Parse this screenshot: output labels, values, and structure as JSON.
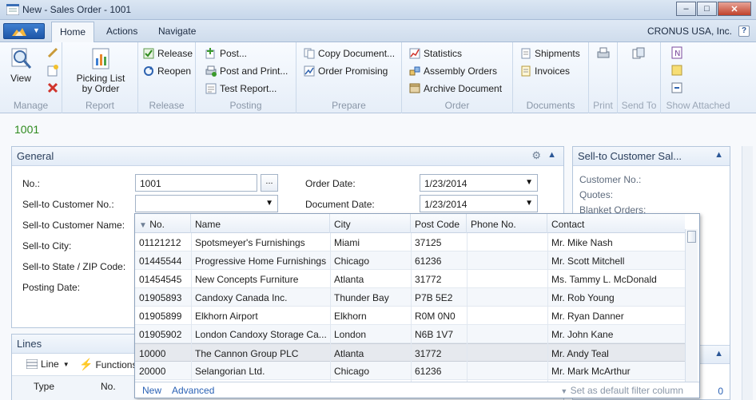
{
  "window": {
    "title": "New - Sales Order - 1001"
  },
  "tabs": [
    {
      "label": "Home",
      "active": true
    },
    {
      "label": "Actions",
      "active": false
    },
    {
      "label": "Navigate",
      "active": false
    }
  ],
  "company": "CRONUS USA, Inc.",
  "ribbon": {
    "manage": {
      "caption": "Manage",
      "view": "View"
    },
    "report": {
      "caption": "Report",
      "picking_line1": "Picking List",
      "picking_line2": "by Order"
    },
    "release": {
      "caption": "Release",
      "release": "Release",
      "reopen": "Reopen"
    },
    "posting": {
      "caption": "Posting",
      "post": "Post...",
      "post_print": "Post and Print...",
      "test_report": "Test Report..."
    },
    "prepare": {
      "caption": "Prepare",
      "copy_doc": "Copy Document...",
      "order_promising": "Order Promising"
    },
    "order": {
      "caption": "Order",
      "statistics": "Statistics",
      "assembly_orders": "Assembly Orders",
      "archive_document": "Archive Document"
    },
    "documents": {
      "caption": "Documents",
      "shipments": "Shipments",
      "invoices": "Invoices"
    },
    "print": {
      "caption": "Print"
    },
    "send_to": {
      "caption": "Send To"
    },
    "show_attached": {
      "caption": "Show Attached"
    }
  },
  "document_number": "1001",
  "general": {
    "title": "General",
    "no_label": "No.:",
    "no_value": "1001",
    "sell_to_customer_no_label": "Sell-to Customer No.:",
    "sell_to_customer_no_value": "",
    "sell_to_customer_name_label": "Sell-to Customer Name:",
    "sell_to_city_label": "Sell-to City:",
    "sell_to_state_label": "Sell-to State / ZIP Code:",
    "posting_date_label": "Posting Date:",
    "order_date_label": "Order Date:",
    "order_date_value": "1/23/2014",
    "document_date_label": "Document Date:",
    "document_date_value": "1/23/2014"
  },
  "factbox": {
    "title": "Sell-to Customer Sal...",
    "customer_no": "Customer No.:",
    "quotes": "Quotes:",
    "blanket_orders": "Blanket Orders:",
    "bottom_value": "0"
  },
  "lines": {
    "title": "Lines",
    "line_menu": "Line",
    "functions_menu": "Functions",
    "col_type": "Type",
    "col_no": "No."
  },
  "lookup": {
    "columns": [
      "No.",
      "Name",
      "City",
      "Post Code",
      "Phone No.",
      "Contact"
    ],
    "rows": [
      {
        "no": "01121212",
        "name": "Spotsmeyer's Furnishings",
        "city": "Miami",
        "post_code": "37125",
        "phone": "",
        "contact": "Mr. Mike Nash"
      },
      {
        "no": "01445544",
        "name": "Progressive Home Furnishings",
        "city": "Chicago",
        "post_code": "61236",
        "phone": "",
        "contact": "Mr. Scott Mitchell"
      },
      {
        "no": "01454545",
        "name": "New Concepts Furniture",
        "city": "Atlanta",
        "post_code": "31772",
        "phone": "",
        "contact": "Ms. Tammy L. McDonald"
      },
      {
        "no": "01905893",
        "name": "Candoxy Canada Inc.",
        "city": "Thunder Bay",
        "post_code": "P7B 5E2",
        "phone": "",
        "contact": "Mr. Rob Young"
      },
      {
        "no": "01905899",
        "name": "Elkhorn Airport",
        "city": "Elkhorn",
        "post_code": "R0M 0N0",
        "phone": "",
        "contact": "Mr. Ryan Danner"
      },
      {
        "no": "01905902",
        "name": "London Candoxy Storage Ca...",
        "city": "London",
        "post_code": "N6B 1V7",
        "phone": "",
        "contact": "Mr. John Kane"
      },
      {
        "no": "10000",
        "name": "The Cannon Group PLC",
        "city": "Atlanta",
        "post_code": "31772",
        "phone": "",
        "contact": "Mr. Andy Teal"
      },
      {
        "no": "20000",
        "name": "Selangorian Ltd.",
        "city": "Chicago",
        "post_code": "61236",
        "phone": "",
        "contact": "Mr. Mark McArthur"
      }
    ],
    "selected_index": 6,
    "new_link": "New",
    "advanced_link": "Advanced",
    "filter_text": "Set as default filter column"
  }
}
